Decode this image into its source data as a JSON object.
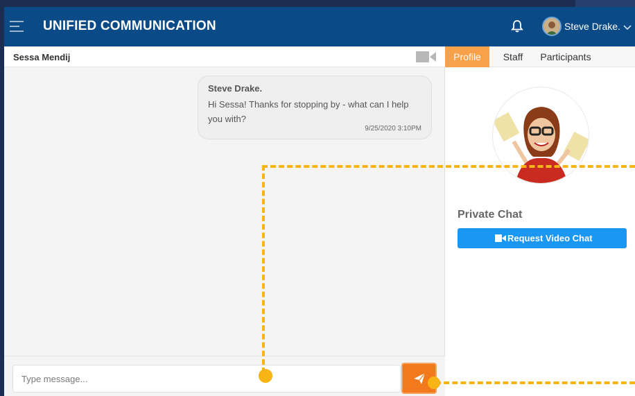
{
  "header": {
    "app_title": "UNIFIED COMMUNICATION",
    "user_name": "Steve Drake.",
    "icons": [
      "menu-icon",
      "bell-icon",
      "chevron-down-icon"
    ]
  },
  "chat": {
    "contact_name": "Sessa Mendij",
    "messages": [
      {
        "sender": "Steve Drake.",
        "text": "Hi Sessa! Thanks for stopping by - what can I help you with?",
        "time": "9/25/2020 3:10PM"
      }
    ],
    "input_placeholder": "Type message..."
  },
  "side": {
    "tabs": [
      {
        "label": "Profile",
        "active": true
      },
      {
        "label": "Staff",
        "active": false
      },
      {
        "label": "Participants",
        "active": false
      }
    ],
    "private_chat_title": "Private Chat",
    "video_button_label": "Request Video Chat"
  },
  "colors": {
    "header_bg": "#0a4a86",
    "accent_orange": "#f37a1c",
    "tab_active": "#f9a04b",
    "button_blue": "#1a97f2",
    "callout_yellow": "#f7b414"
  }
}
